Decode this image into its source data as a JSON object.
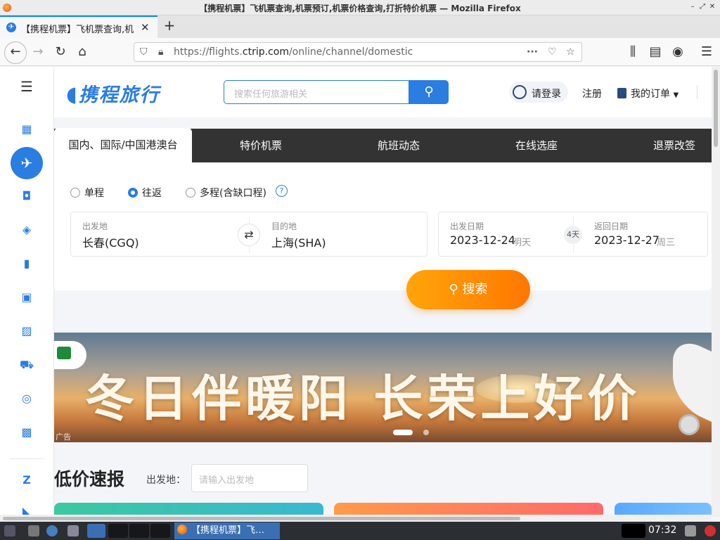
{
  "window": {
    "title": "【携程机票】飞机票查询,机票预订,机票价格查询,打折特价机票 — Mozilla Firefox"
  },
  "browser": {
    "tab_title": "【携程机票】飞机票查询,机票预订,机票价格查询,打折特价机票",
    "url_prefix": "https://flights.",
    "url_domain": "ctrip.com",
    "url_path": "/online/channel/domestic"
  },
  "header": {
    "logo_text": "携程旅行",
    "search_placeholder": "搜索任何旅游相关",
    "login": "请登录",
    "register": "注册",
    "orders": "我的订单"
  },
  "tabs": [
    "国内、国际/中国港澳台",
    "特价机票",
    "航班动态",
    "在线选座",
    "退票改签"
  ],
  "trip_types": [
    {
      "label": "单程",
      "selected": false
    },
    {
      "label": "往返",
      "selected": true
    },
    {
      "label": "多程(含缺口程)",
      "selected": false
    }
  ],
  "form": {
    "from_label": "出发地",
    "from_value": "长春(CGQ)",
    "to_label": "目的地",
    "to_value": "上海(SHA)",
    "depart_label": "出发日期",
    "depart_date": "2023-12-24",
    "depart_sub": "明天",
    "nights": "4天",
    "return_label": "返回日期",
    "return_date": "2023-12-27",
    "return_sub": "周三",
    "search_button": "搜索"
  },
  "banner": {
    "headline": "冬日伴暖阳 长荣上好价",
    "ad_label": "广告"
  },
  "low_price": {
    "title": "低价速报",
    "from_label": "出发地：",
    "from_placeholder": "请输入出发地"
  },
  "taskbar": {
    "window_label": "【携程机票】飞…",
    "clock": "07:32"
  },
  "colors": {
    "brand": "#2a7de1",
    "search_orange": "#ff8a00"
  }
}
